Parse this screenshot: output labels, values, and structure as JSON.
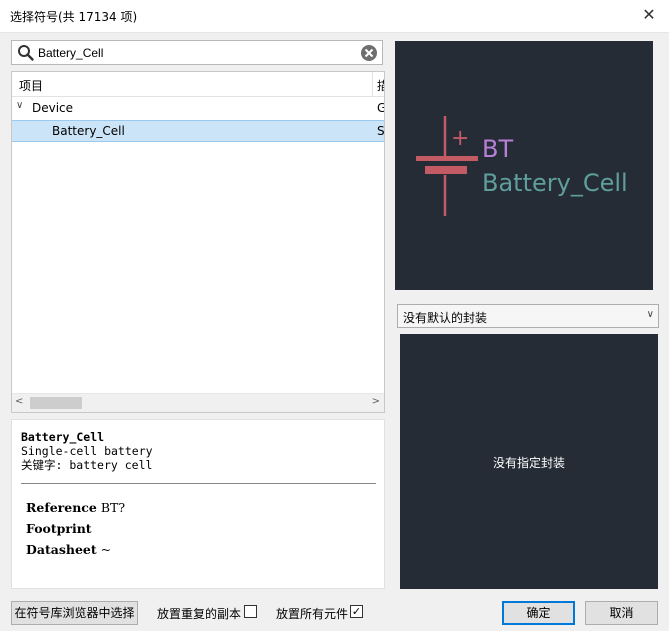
{
  "window": {
    "title": "选择符号(共 17134 项)",
    "close_glyph": "✕"
  },
  "search": {
    "value": "Battery_Cell"
  },
  "tree": {
    "col_item": "项目",
    "col_desc": "描",
    "group": {
      "label": "Device",
      "desc": "G",
      "expander": "∨"
    },
    "item": {
      "label": "Battery_Cell",
      "desc": "S"
    },
    "scroll_left": "<",
    "scroll_right": ">"
  },
  "details": {
    "name": "Battery_Cell",
    "description": "Single-cell battery",
    "keywords": "关键字: battery cell",
    "reference_label": "Reference",
    "reference_value": "BT?",
    "footprint_label": "Footprint",
    "footprint_value": "",
    "datasheet_label": "Datasheet",
    "datasheet_value": "~"
  },
  "symbol_preview": {
    "ref_text": "BT",
    "value_text": "Battery_Cell",
    "plus": "+",
    "ref_color": "#b77fd6",
    "value_color": "#5f9e9c",
    "body_color": "#c45a64"
  },
  "footprint": {
    "select_value": "没有默认的封装",
    "select_chevron": "∨",
    "empty_message": "没有指定封装"
  },
  "bottom": {
    "browse_button": "在符号库浏览器中选择",
    "place_repeated_label": "放置重复的副本",
    "place_repeated_checked": false,
    "place_all_label": "放置所有元件",
    "place_all_checked": true,
    "check_glyph": "✓",
    "ok_button": "确定",
    "cancel_button": "取消"
  },
  "colors": {
    "accent": "#0078d7",
    "selection": "#cce4f7",
    "preview_bg": "#252c36"
  }
}
